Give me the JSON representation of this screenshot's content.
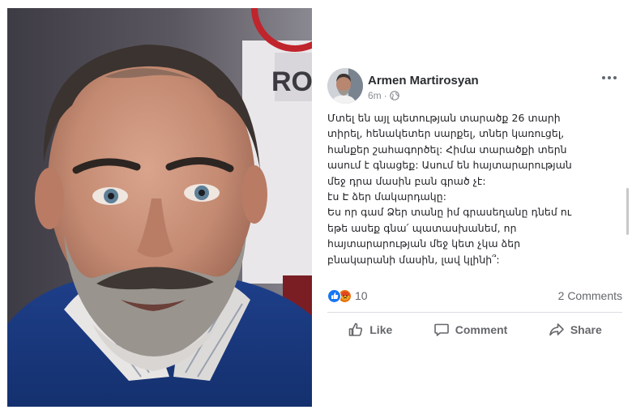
{
  "photo": {
    "description_icon": "man-portrait-photo",
    "backdrop_text": "RO"
  },
  "post": {
    "author": "Armen Martirosyan",
    "time": "6m",
    "audience_icon": "globe-icon",
    "more_icon": "more-dots-icon",
    "body_lines": [
      "Մտել են այլ պետության տարածք 26 տարի",
      "տիրել, հենակետեր սարքել, տներ կառուցել,",
      "հանքեր շահագործել: Հիմա տարածքի տերն",
      "ասում է գնացեք: Ասում են հայտարարության",
      "մեջ դրա մասին բան գրած չէ:",
      "էս Է ձեր մակարդակը:",
      "Ես որ գամ Ձեր տանը իմ գրասեղանը դնեմ ու",
      "եթե  ասեք գնա՛ պատասխանեմ, որ",
      "հայտարարության մեջ կետ չկա ձեր",
      "բնակարանի մասին, լավ կլինի՞:"
    ],
    "reactions": {
      "count": "10",
      "types": [
        "like",
        "angry"
      ]
    },
    "comments_count": "2 Comments",
    "actions": {
      "like": "Like",
      "comment": "Comment",
      "share": "Share"
    },
    "colors": {
      "like_blue": "#1877f2",
      "angry_orange": "#e9710f",
      "secondary_text": "#65676b"
    }
  }
}
